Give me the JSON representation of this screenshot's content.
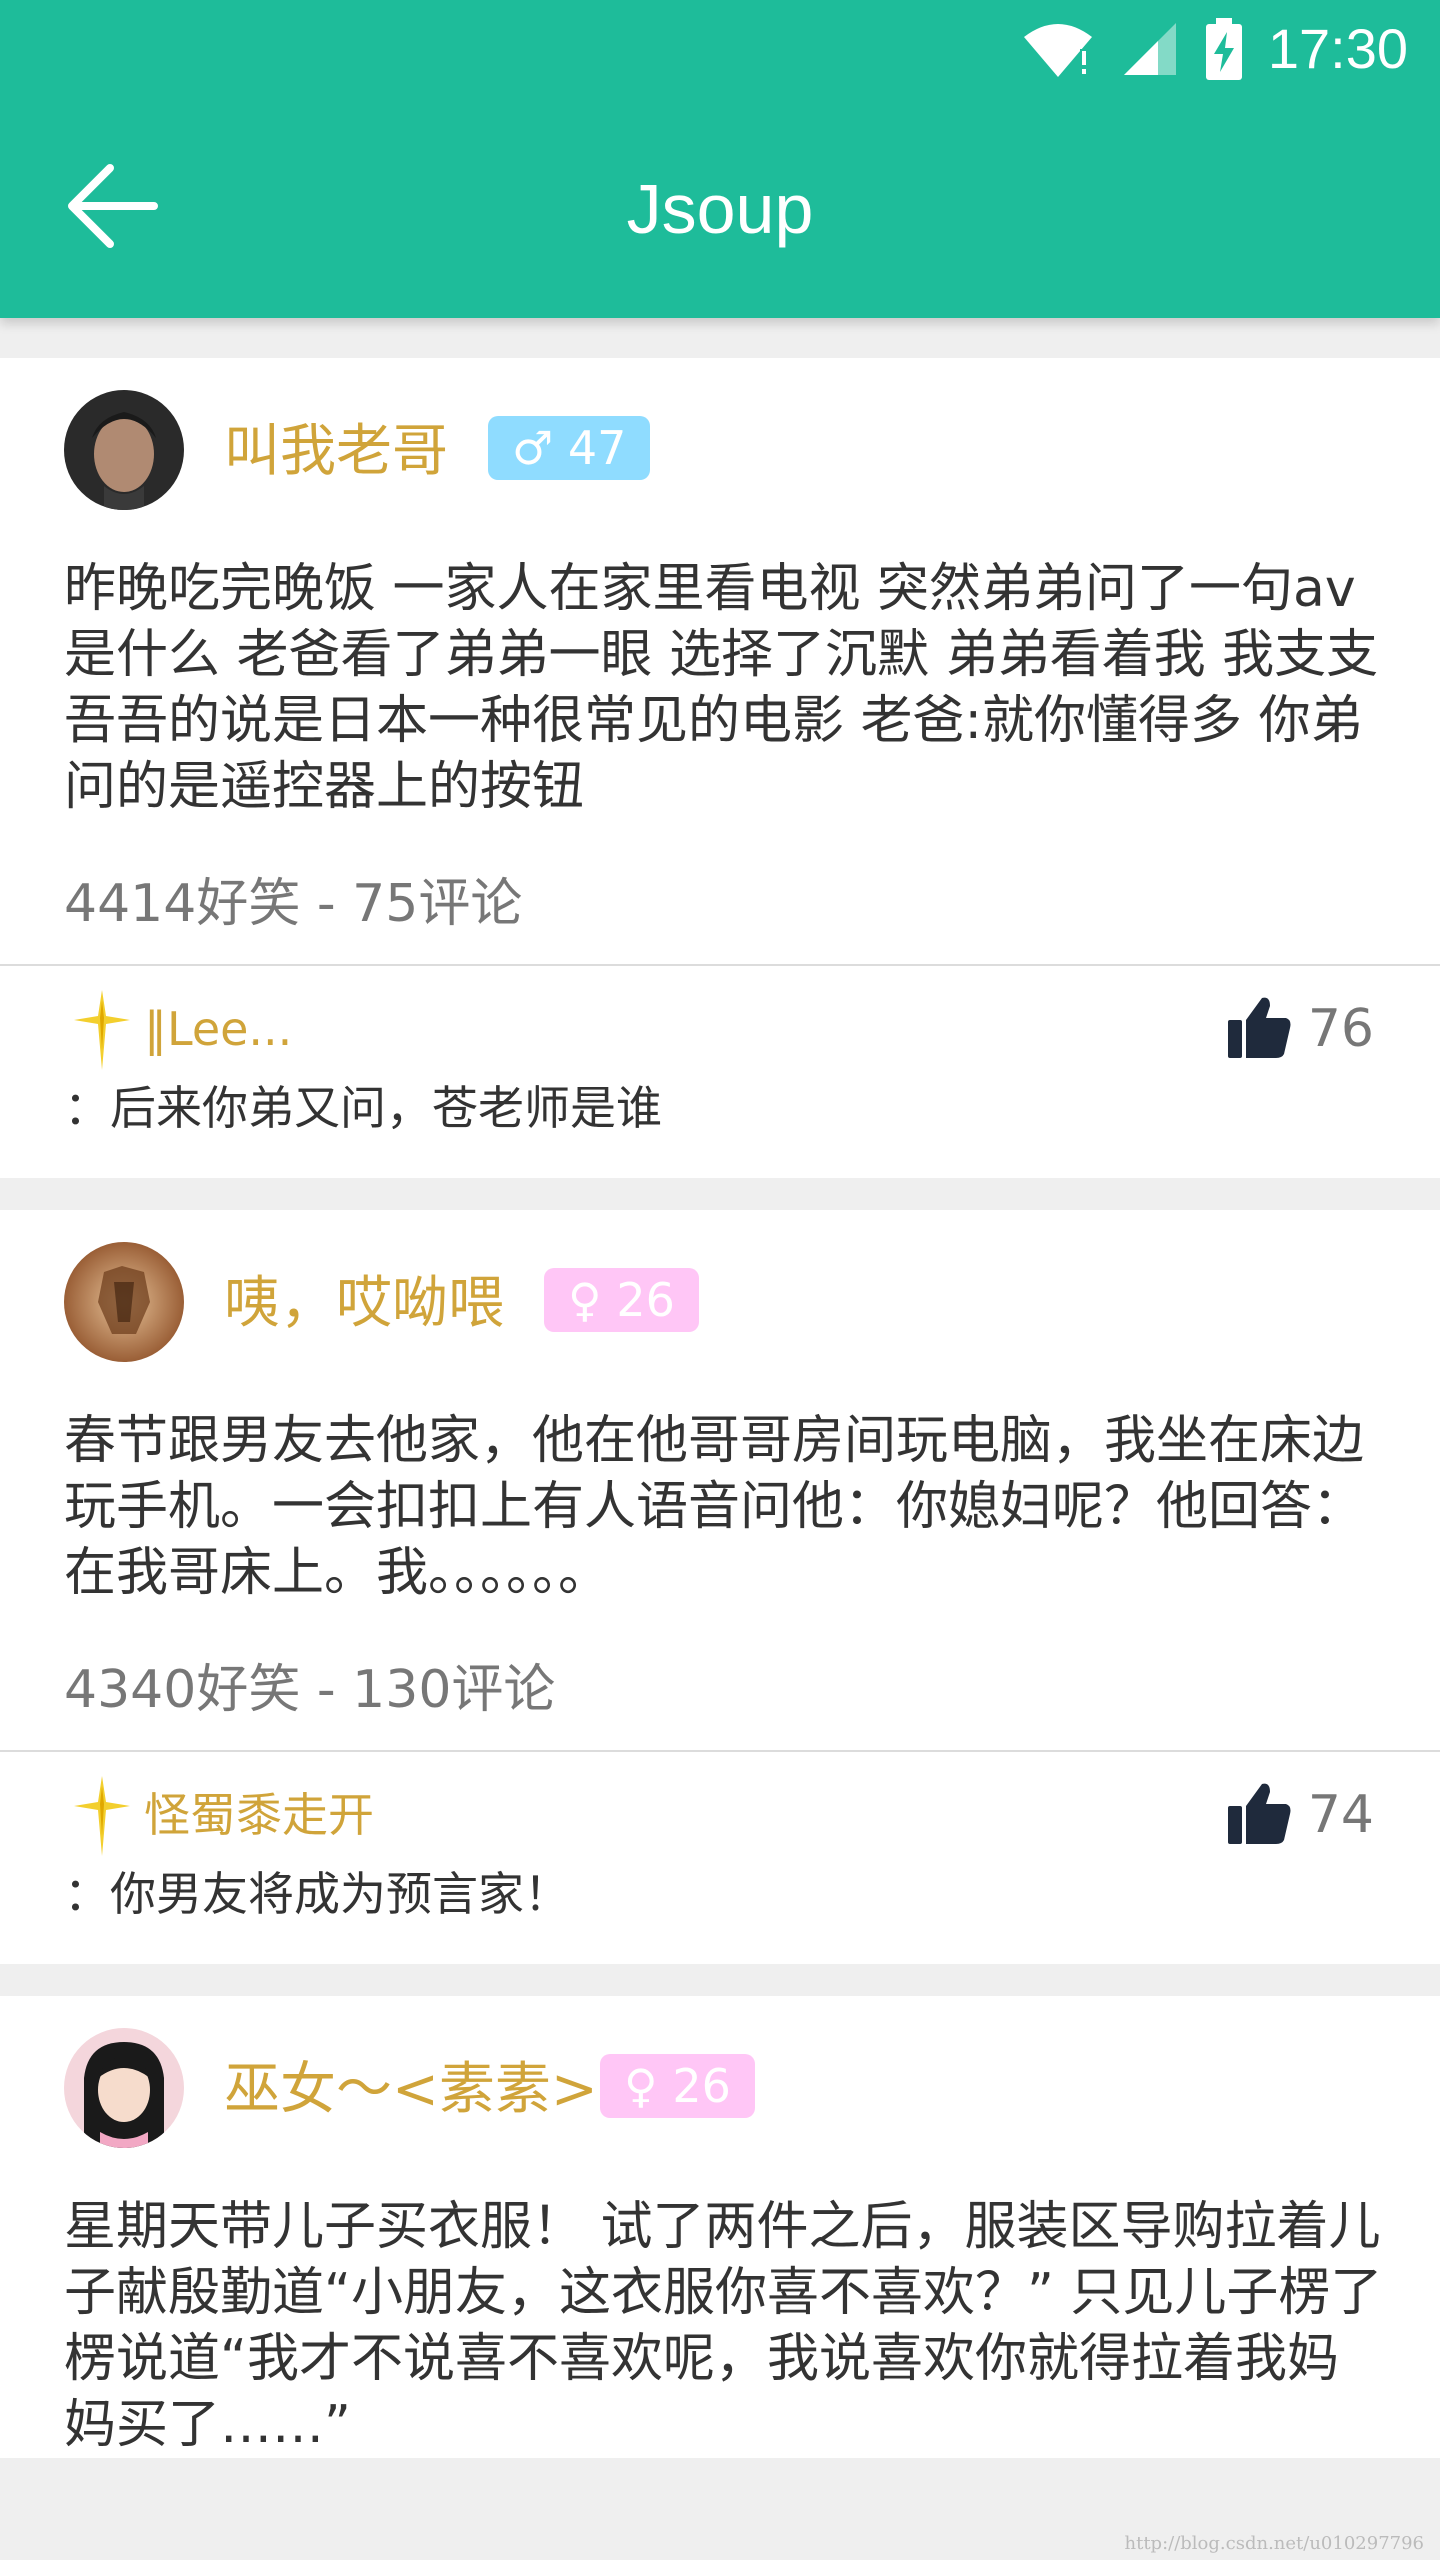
{
  "status_bar": {
    "time": "17:30",
    "icons": [
      "wifi-icon",
      "cell-signal-icon",
      "battery-charging-icon"
    ]
  },
  "app_bar": {
    "title": "Jsoup",
    "back_icon": "arrow-back-icon"
  },
  "colors": {
    "primary": "#1ebc9a",
    "username": "#d0a43a",
    "male_badge": "#8fdcff",
    "female_badge": "#ffc6f6"
  },
  "posts": [
    {
      "username": "叫我老哥",
      "gender_icon": "male-icon",
      "badge": "♂ 47",
      "content": "昨晚吃完晚饭 一家人在家里看电视 突然弟弟问了一句av是什么 老爸看了弟弟一眼 选择了沉默 弟弟看着我 我支支吾吾的说是日本一种很常见的电影 老爸:就你懂得多 你弟问的是遥控器上的按钮",
      "stats": "4414好笑 - 75评论",
      "top_comment": {
        "username": "‖Lee...",
        "likes": "76",
        "text": "：后来你弟又问，苍老师是谁"
      }
    },
    {
      "username": "咦，哎呦喂",
      "gender_icon": "female-icon",
      "badge": "♀ 26",
      "content": "春节跟男友去他家，他在他哥哥房间玩电脑，我坐在床边玩手机。一会扣扣上有人语音问他：你媳妇呢？他回答：在我哥床上。我。。。。。。",
      "stats": "4340好笑 - 130评论",
      "top_comment": {
        "username": "怪蜀黍走开",
        "likes": "74",
        "text": "：你男友将成为预言家！"
      }
    },
    {
      "username": "巫女～<素素>",
      "gender_icon": "female-icon",
      "badge": "♀ 26",
      "content": "星期天带儿子买衣服！ 试了两件之后，服装区导购拉着儿子献殷勤道“小朋友，这衣服你喜不喜欢？” 只见儿子楞了楞说道“我才不说喜不喜欢呢，我说喜欢你就得拉着我妈妈买了……”"
    }
  ],
  "watermark": "http://blog.csdn.net/u010297796"
}
